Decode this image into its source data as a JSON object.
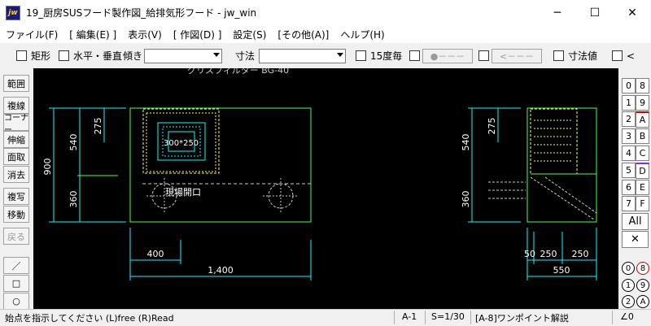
{
  "window": {
    "app_icon_label": "jw",
    "title": "19_厨房SUSフード製作図_給排気形フード - jw_win",
    "minimize_glyph": "─",
    "maximize_glyph": "☐",
    "close_glyph": "✕"
  },
  "menu": [
    "ファイル(F)",
    "[ 編集(E) ]",
    "表示(V)",
    "[ 作図(D) ]",
    "設定(S)",
    "[その他(A)]",
    "ヘルプ(H)"
  ],
  "toolbar": {
    "rect_label": "矩形",
    "horiz_vert_label": "水平・垂直",
    "angle_label": "傾き",
    "angle_value": "",
    "dimension_label": "寸法",
    "dimension_value": "",
    "step15_label": "15度毎",
    "dot_box_label": "●－－－",
    "arrow_box_label": "<－－－",
    "dim_value_label": "寸法値",
    "lt_label": "<"
  },
  "left_tools": [
    "範囲",
    "複線",
    "コーナー",
    "伸縮",
    "面取",
    "消去",
    "複写",
    "移動",
    "戻る"
  ],
  "shape_tools": {
    "line_glyph": "／",
    "rect_glyph": "□",
    "circle_glyph": "○"
  },
  "layers": {
    "left_col": [
      "0",
      "1",
      "2",
      "3",
      "4",
      "5",
      "6",
      "7"
    ],
    "right_col": [
      "8",
      "9",
      "A",
      "B",
      "C",
      "D",
      "E",
      "F"
    ],
    "all_label": "All",
    "x_label": "✕",
    "group_left": [
      "0",
      "1",
      "2"
    ],
    "group_right": [
      "8",
      "9",
      "A"
    ]
  },
  "drawing": {
    "top_label": "グリスフィルター BG-40",
    "filter_size": "300*250",
    "opening_label": "現場開口",
    "dim_540a": "540",
    "dim_275a": "275",
    "dim_900": "900",
    "dim_360a": "360",
    "dim_400": "400",
    "dim_1400": "1,400",
    "dim_540b": "540",
    "dim_275b": "275",
    "dim_360b": "360",
    "dim_50": "50",
    "dim_250a": "250",
    "dim_250b": "250",
    "dim_550": "550"
  },
  "status": {
    "message": "始点を指示してください (L)free (R)Read",
    "paper": "A-1",
    "scale": "S=1/30",
    "hint": "[A-8]ワンポイント解説",
    "angle": "∠0"
  }
}
